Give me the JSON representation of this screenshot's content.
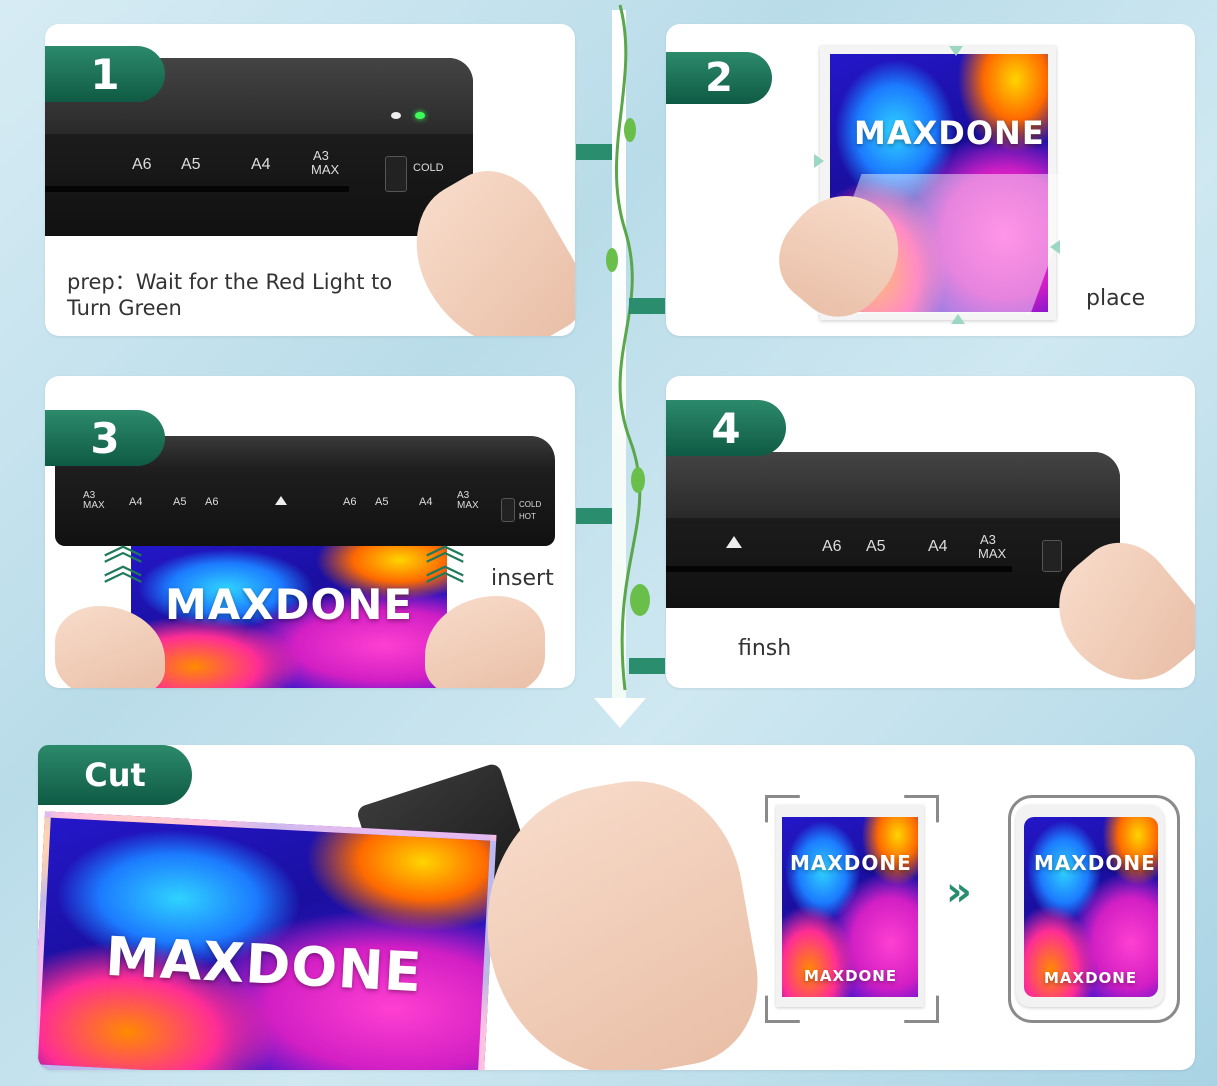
{
  "steps": [
    {
      "number": "1",
      "caption_line1": "prep：Wait for the Red Light to",
      "caption_line2": "Turn Green"
    },
    {
      "number": "2",
      "caption": "place"
    },
    {
      "number": "3",
      "caption": "insert"
    },
    {
      "number": "4",
      "caption": "finsh"
    }
  ],
  "cut": {
    "label": "Cut"
  },
  "brand": "MAXDONE",
  "machine_labels": {
    "a6": "A6",
    "a5": "A5",
    "a4": "A4",
    "a3": "A3",
    "max": "MAX",
    "cold": "COLD",
    "hot": "HOT"
  },
  "colors": {
    "badge": "#1f7a5c",
    "accent": "#2a8e6e",
    "poster": "#2417c9"
  },
  "icons": [
    "vine-icon",
    "down-arrow-icon",
    "double-chevron-icon",
    "hand-icon",
    "up-arrow-icon"
  ]
}
